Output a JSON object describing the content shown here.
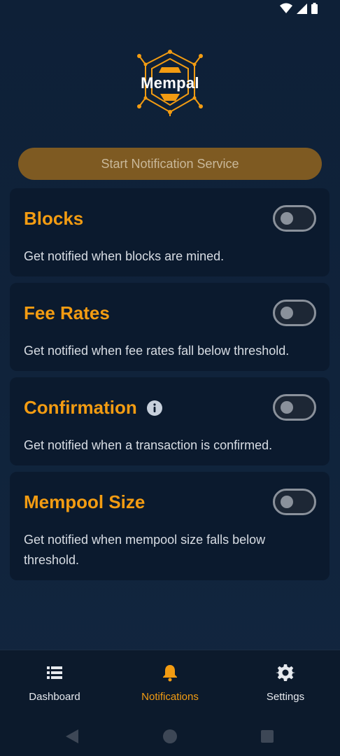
{
  "app": {
    "logo_text": "Mempal",
    "accent_color": "#f39c12",
    "button_color": "#7e5a22"
  },
  "start_button": {
    "label": "Start Notification Service"
  },
  "cards": [
    {
      "title": "Blocks",
      "description": "Get notified when blocks are mined.",
      "enabled": false,
      "has_info_icon": false
    },
    {
      "title": "Fee Rates",
      "description": "Get notified when fee rates fall below threshold.",
      "enabled": false,
      "has_info_icon": false
    },
    {
      "title": "Confirmation",
      "description": "Get notified when a transaction is confirmed.",
      "enabled": false,
      "has_info_icon": true
    },
    {
      "title": "Mempool Size",
      "description": "Get notified when mempool size falls below threshold.",
      "enabled": false,
      "has_info_icon": false
    }
  ],
  "nav": {
    "items": [
      {
        "label": "Dashboard",
        "icon": "list-icon",
        "active": false
      },
      {
        "label": "Notifications",
        "icon": "bell-icon",
        "active": true
      },
      {
        "label": "Settings",
        "icon": "gear-icon",
        "active": false
      }
    ]
  },
  "status_bar": {
    "icons": [
      "wifi-icon",
      "signal-icon",
      "battery-icon"
    ]
  },
  "system_nav": {
    "icons": [
      "back-icon",
      "home-icon",
      "recents-icon"
    ]
  }
}
